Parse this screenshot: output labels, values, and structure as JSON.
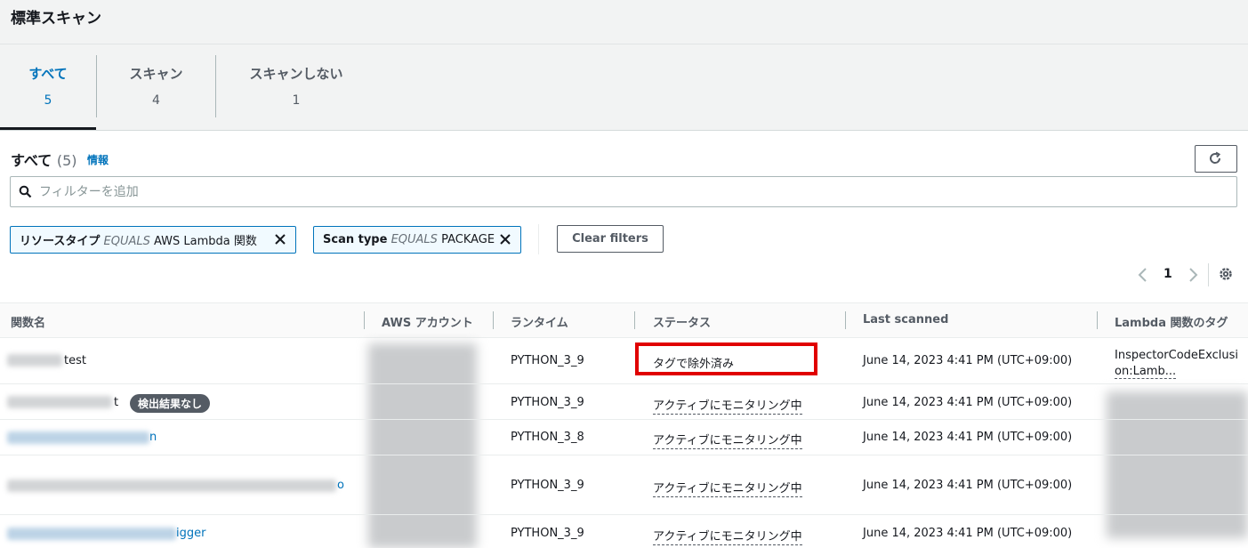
{
  "page_title": "標準スキャン",
  "tabs": [
    {
      "label": "すべて",
      "count": "5"
    },
    {
      "label": "スキャン",
      "count": "4"
    },
    {
      "label": "スキャンしない",
      "count": "1"
    }
  ],
  "section": {
    "title": "すべて",
    "count": "(5)",
    "info": "情報"
  },
  "search": {
    "placeholder": "フィルターを追加"
  },
  "filters": [
    {
      "key": "リソースタイプ",
      "op": "EQUALS",
      "value": "AWS Lambda 関数"
    },
    {
      "key": "Scan type",
      "op": "EQUALS",
      "value": "PACKAGE"
    }
  ],
  "clear_filters": "Clear filters",
  "pagination": {
    "page": "1"
  },
  "table": {
    "headers": [
      "関数名",
      "AWS アカウント",
      "ランタイム",
      "ステータス",
      "Last scanned",
      "Lambda 関数のタグ"
    ],
    "rows": [
      {
        "name_suffix": "test",
        "runtime": "PYTHON_3_9",
        "status": "タグで除外済み",
        "last_scanned": "June 14, 2023 4:41 PM (UTC+09:00)",
        "tag_line1": "InspectorCodeExclusi",
        "tag_line2": "on:Lamb..."
      },
      {
        "name_suffix": "t",
        "badge": "検出結果なし",
        "runtime": "PYTHON_3_9",
        "status": "アクティブにモニタリング中",
        "last_scanned": "June 14, 2023 4:41 PM (UTC+09:00)"
      },
      {
        "name_suffix": "n",
        "runtime": "PYTHON_3_8",
        "status": "アクティブにモニタリング中",
        "last_scanned": "June 14, 2023 4:41 PM (UTC+09:00)"
      },
      {
        "name_suffix": "o",
        "runtime": "PYTHON_3_9",
        "status": "アクティブにモニタリング中",
        "last_scanned": "June 14, 2023 4:41 PM (UTC+09:00)"
      },
      {
        "name_suffix": "igger",
        "runtime": "PYTHON_3_9",
        "status": "アクティブにモニタリング中",
        "last_scanned": "June 14, 2023 4:41 PM (UTC+09:00)"
      }
    ]
  },
  "colors": {
    "accent": "#0073bb",
    "highlight": "#e00000",
    "badge_bg": "#545b64"
  },
  "icons": [
    "search-icon",
    "refresh-icon",
    "close-icon",
    "chevron-left-icon",
    "chevron-right-icon",
    "gear-icon"
  ]
}
